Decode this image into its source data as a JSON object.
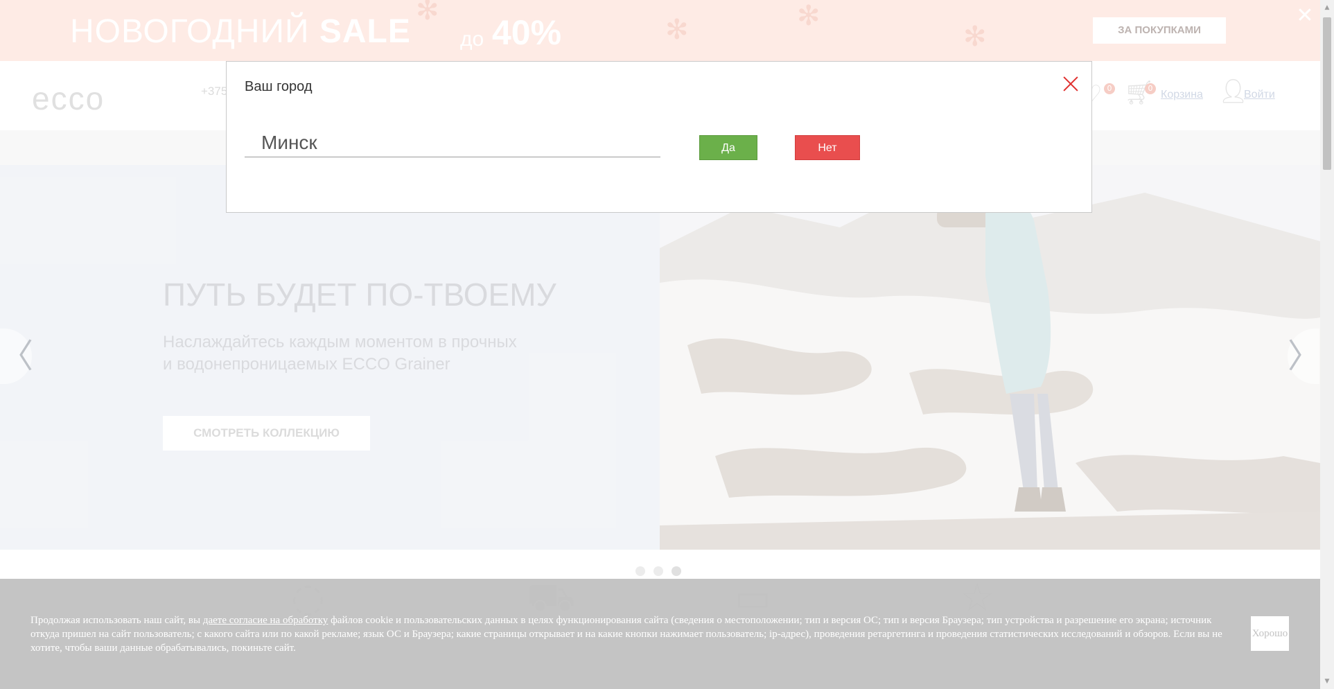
{
  "promo": {
    "title_prefix": "НОВОГОДНИЙ",
    "title_bold": "SALE",
    "to": "до",
    "percent": "40%",
    "button": "ЗА ПОКУПКАМИ",
    "close": "✕"
  },
  "header": {
    "logo": "ecco",
    "phone": "+375",
    "wishlist_count": "0",
    "cart_count": "0",
    "cart_label": "Корзина",
    "login_label": "Войти"
  },
  "slider": {
    "heading": "ПУТЬ БУДЕТ ПО-ТВОЕМУ",
    "text_line1": "Наслаждайтесь каждым моментом в прочных",
    "text_line2": "и водонепроницаемых ECCO Grainer",
    "button": "СМОТРЕТЬ КОЛЛЕКЦИЮ",
    "prev": "〈",
    "next": "〉",
    "slide_count": 3,
    "active_slide": 3
  },
  "modal": {
    "title": "Ваш город",
    "city_value": "Минск",
    "yes": "Да",
    "no": "Нет"
  },
  "cookie": {
    "text_before": "Продолжая использовать наш сайт, вы ",
    "link": "даете согласие на обработку",
    "text_after": " файлов cookie и пользовательских данных в целях функционирования сайта (сведения о местоположении; тип и версия ОС; тип и версия Браузера; тип устройства и разрешение его экрана; источник откуда пришел на сайт пользователь; с какого сайта или по какой рекламе; язык ОС и Браузера; какие страницы открывает и на какие кнопки нажимает пользователь; ip-адрес), проведения ретаргетинга и проведения статистических исследований и обзоров. Если вы не хотите, чтобы ваши данные обрабатывались, покиньте сайт.",
    "button": "Хорошо"
  },
  "colors": {
    "promo_bg": "#fde0d8",
    "yes_button": "#6bb04a",
    "no_button": "#e94e4e",
    "close_x": "#e0312f",
    "cookie_bg": "#c0c0c0"
  }
}
